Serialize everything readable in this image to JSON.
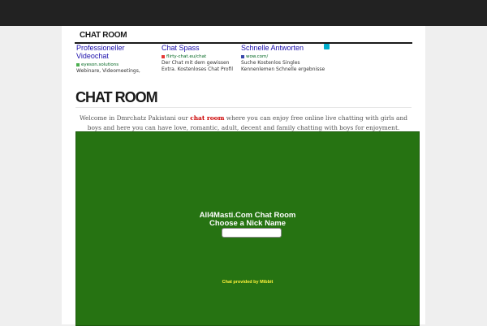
{
  "nav": {
    "link": "CHAT ROOM"
  },
  "ads": [
    {
      "title": "Professioneller Videochat",
      "url": "eyeson.solutions",
      "badge_color": "#4caf50",
      "description": "Webinare, Videomeetings,"
    },
    {
      "title": "Chat Spass",
      "url": "flirty-chat.eu/chat",
      "badge_color": "#e53935",
      "description": "Der Chat mit dem gewissen Extra. Kostenloses Chat Profil"
    },
    {
      "title": "Schnelle Antworten",
      "url": "wow.com/",
      "badge_color": "#3949ab",
      "description": "Suche Kostenlos Singles Kennenlemen Schnelle ergebnisse"
    }
  ],
  "page": {
    "title": "CHAT ROOM",
    "intro_before": "Welcome in Dmrchatz Pakistani our ",
    "intro_link": "chat room",
    "intro_after": " where you can enjoy free online live chatting with girls and boys and here you can have love, romantic, adult, decent and family chatting with boys for enjoyment."
  },
  "chat": {
    "title": "All4Masti.Com Chat Room",
    "prompt": "Choose a Nick Name",
    "nick_value": "",
    "credit": "Chat provided by Mibbit"
  },
  "colors": {
    "topbar": "#222222",
    "background": "#efefef",
    "chat_bg": "#267312",
    "link_red": "#cc0000",
    "credit_yellow": "#fff23a",
    "ad_title_blue": "#1a0dab"
  }
}
